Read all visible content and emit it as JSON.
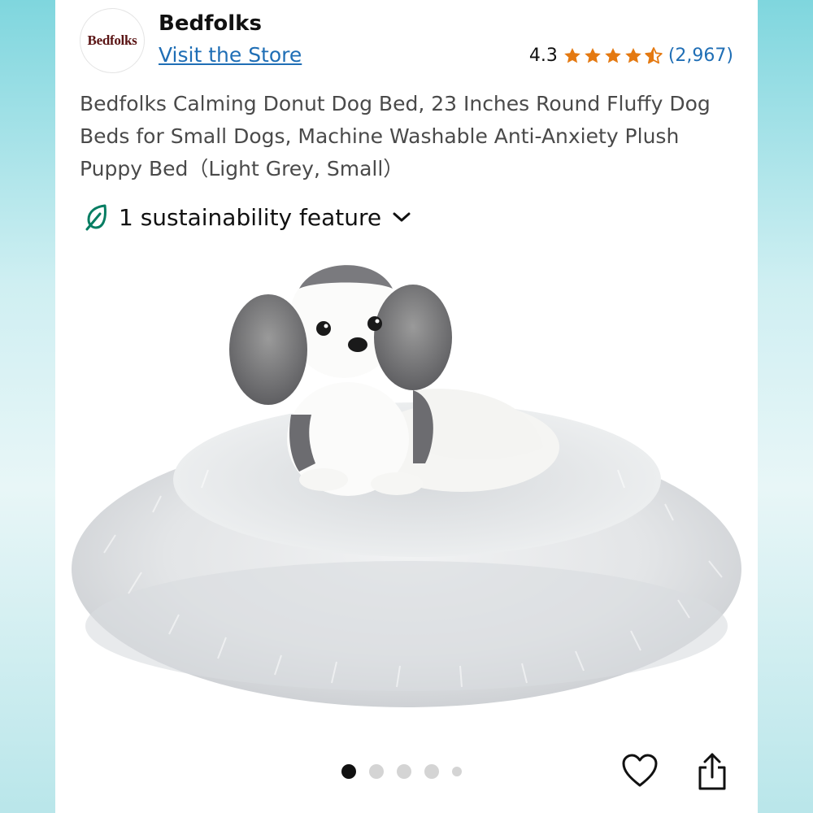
{
  "store": {
    "logo_text": "Bedfolks",
    "name": "Bedfolks",
    "visit_label": "Visit the Store"
  },
  "rating": {
    "value": "4.3",
    "stars": 4.3,
    "count": "(2,967)",
    "star_color": "#e47911"
  },
  "product": {
    "title": "Bedfolks Calming Donut Dog Bed, 23 Inches Round Fluffy Dog Beds for Small Dogs, Machine Washable Anti-Anxiety Plush Puppy Bed（Light Grey, Small）"
  },
  "sustainability": {
    "label": "1 sustainability feature",
    "icon": "leaf-icon",
    "accent": "#067d62"
  },
  "carousel": {
    "total_dots": 5,
    "active_index": 1
  },
  "actions": {
    "wishlist_icon": "heart-icon",
    "share_icon": "share-icon"
  },
  "colors": {
    "link": "#1f6eb5",
    "text_primary": "#111111",
    "text_secondary": "#4a4a4a"
  }
}
